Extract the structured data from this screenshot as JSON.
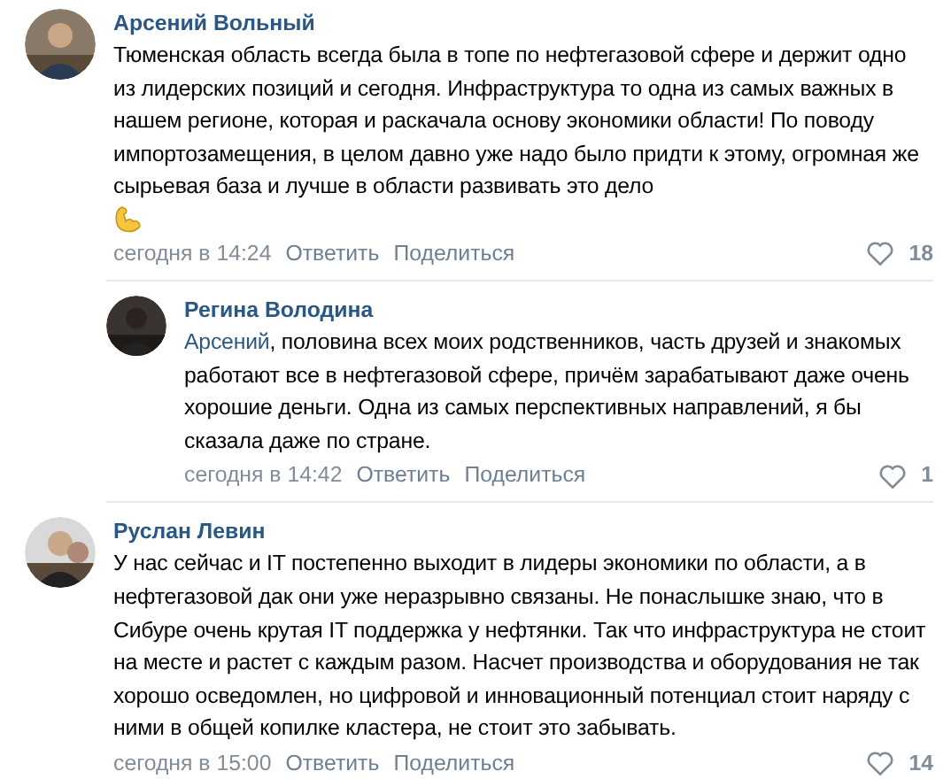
{
  "comments": [
    {
      "author": "Арсений Вольный",
      "text": "Тюменская область всегда была в топе по нефтегазовой сфере и держит одно из лидерских позиций и сегодня. Инфраструктура то одна из самых важных в нашем регионе, которая и раскачала основу экономики области! По поводу импортозамещения, в целом давно уже надо было придти к этому, огромная же сырьевая база и лучше в области развивать это дело",
      "time": "сегодня в 14:24",
      "reply": "Ответить",
      "share": "Поделиться",
      "likes": "18",
      "replies": [
        {
          "author": "Регина Володина",
          "mention": "Арсений",
          "text": ", половина всех моих родственников, часть друзей и знакомых работают все в нефтегазовой сфере, причём зарабатывают даже очень хорошие деньги. Одна из самых перспективных направлений, я бы сказала даже по стране.",
          "time": "сегодня в 14:42",
          "reply": "Ответить",
          "share": "Поделиться",
          "likes": "1"
        }
      ]
    },
    {
      "author": "Руслан Левин",
      "text": "У нас сейчас и IT постепенно выходит в лидеры экономики по области, а в нефтегазовой дак они уже неразрывно связаны. Не понаслышке знаю, что в Сибуре очень крутая IT поддержка у нефтянки. Так что инфраструктура не стоит на месте и растет с каждым разом. Насчет производства и оборудования не так хорошо осведомлен, но цифровой и инновационный потенциал стоит наряду с ними в общей копилке кластера, не стоит это забывать.",
      "time": "сегодня в 15:00",
      "reply": "Ответить",
      "share": "Поделиться",
      "likes": "14"
    }
  ]
}
